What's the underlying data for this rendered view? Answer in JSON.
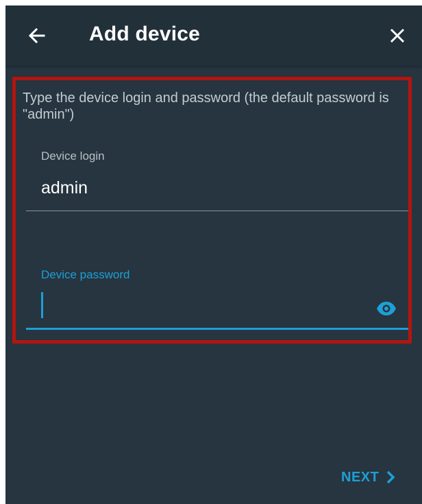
{
  "appbar": {
    "title": "Add device",
    "back_icon": "arrow-left-icon",
    "close_icon": "close-icon"
  },
  "form": {
    "instructions": "Type the device login and password (the default password is \"admin\")",
    "login": {
      "label": "Device login",
      "value": "admin"
    },
    "password": {
      "label": "Device password",
      "value": "",
      "visibility_icon": "eye-icon"
    }
  },
  "footer": {
    "next_label": "NEXT",
    "next_icon": "chevron-right-icon"
  },
  "colors": {
    "background": "#263540",
    "appbar": "#22303a",
    "accent": "#1e9fd6",
    "highlight": "#b3150f"
  }
}
